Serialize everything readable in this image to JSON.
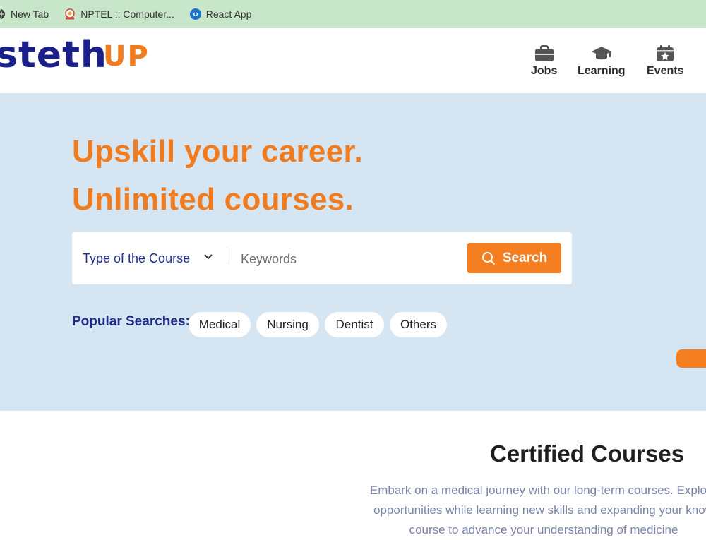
{
  "bookmarks": [
    {
      "label": "New Tab",
      "icon": "globe-icon"
    },
    {
      "label": "NPTEL :: Computer...",
      "icon": "nptel-logo-icon"
    },
    {
      "label": "React App",
      "icon": "react-icon"
    }
  ],
  "header": {
    "logo_main": "steth",
    "logo_accent": "UP",
    "nav": [
      {
        "label": "Jobs",
        "icon": "briefcase-icon"
      },
      {
        "label": "Learning",
        "icon": "graduation-cap-icon"
      },
      {
        "label": "Events",
        "icon": "calendar-icon"
      }
    ]
  },
  "hero": {
    "line1": "Upskill your career.",
    "line2": "Unlimited courses.",
    "search": {
      "course_type": "Type of the Course",
      "keywords_placeholder": "Keywords",
      "button_label": "Search"
    },
    "popular_label": "Popular Searches:",
    "popular_tags": [
      "Medical",
      "Nursing",
      "Dentist",
      "Others"
    ]
  },
  "certified": {
    "title": "Certified Courses",
    "description_lines": [
      "Embark on a medical journey with our long-term courses. Explore",
      "opportunities while learning new skills and expanding your know",
      "course to advance your understanding of medicine"
    ]
  },
  "colors": {
    "brand_navy": "#1b1f8a",
    "brand_orange": "#f07c1f",
    "hero_bg": "#d5e5f1",
    "bookmark_bar": "#c8e6c9"
  }
}
